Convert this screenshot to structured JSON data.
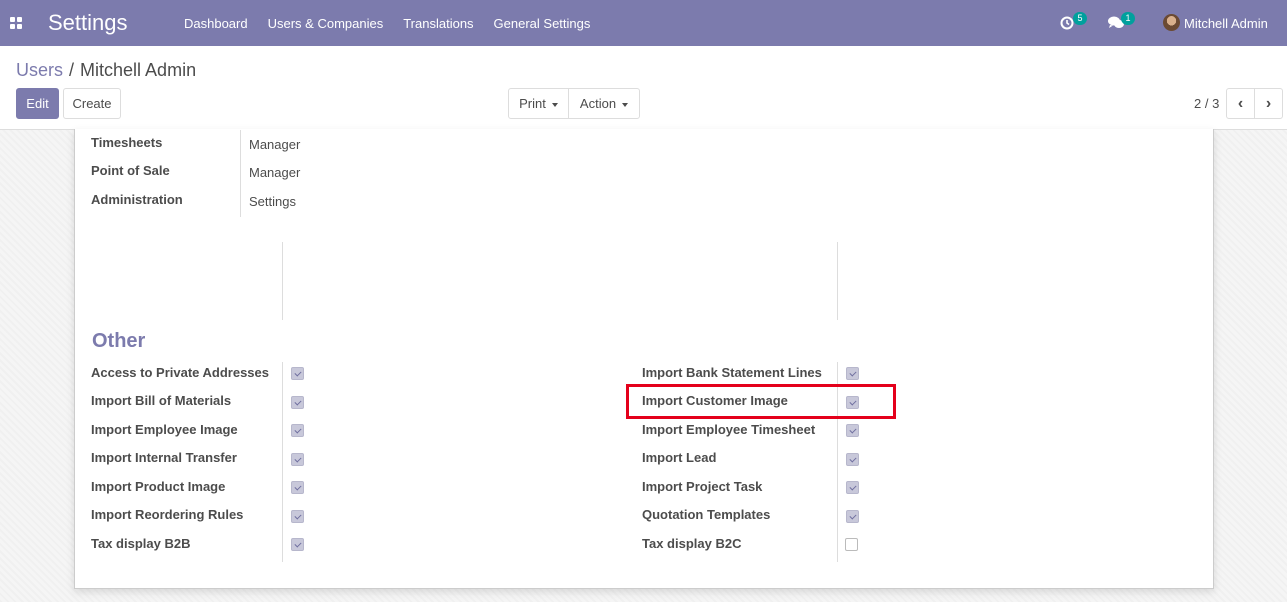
{
  "navbar": {
    "app_title": "Settings",
    "menu": [
      "Dashboard",
      "Users & Companies",
      "Translations",
      "General Settings"
    ],
    "activity_badge": "5",
    "messages_badge": "1",
    "user_name": "Mitchell Admin"
  },
  "breadcrumb": {
    "parent": "Users",
    "separator": "/",
    "current": "Mitchell Admin"
  },
  "buttons": {
    "edit": "Edit",
    "create": "Create",
    "print": "Print",
    "action": "Action"
  },
  "pager": {
    "value": "2 / 3"
  },
  "access_rights": [
    {
      "label": "Timesheets",
      "value": "Manager"
    },
    {
      "label": "Point of Sale",
      "value": "Manager"
    },
    {
      "label": "Administration",
      "value": "Settings"
    }
  ],
  "other": {
    "title": "Other",
    "left": [
      {
        "label": "Access to Private Addresses",
        "checked": true
      },
      {
        "label": "Import Bill of Materials",
        "checked": true
      },
      {
        "label": "Import Employee Image",
        "checked": true
      },
      {
        "label": "Import Internal Transfer",
        "checked": true
      },
      {
        "label": "Import Product Image",
        "checked": true
      },
      {
        "label": "Import Reordering Rules",
        "checked": true
      },
      {
        "label": "Tax display B2B",
        "checked": true
      }
    ],
    "right": [
      {
        "label": "Import Bank Statement Lines",
        "checked": true
      },
      {
        "label": "Import Customer Image",
        "checked": true
      },
      {
        "label": "Import Employee Timesheet",
        "checked": true
      },
      {
        "label": "Import Lead",
        "checked": true
      },
      {
        "label": "Import Project Task",
        "checked": true
      },
      {
        "label": "Quotation Templates",
        "checked": true
      },
      {
        "label": "Tax display B2C",
        "checked": false
      }
    ]
  },
  "colors": {
    "brand": "#7c7bad",
    "badge": "#00a09d",
    "highlight": "#e4001b"
  }
}
